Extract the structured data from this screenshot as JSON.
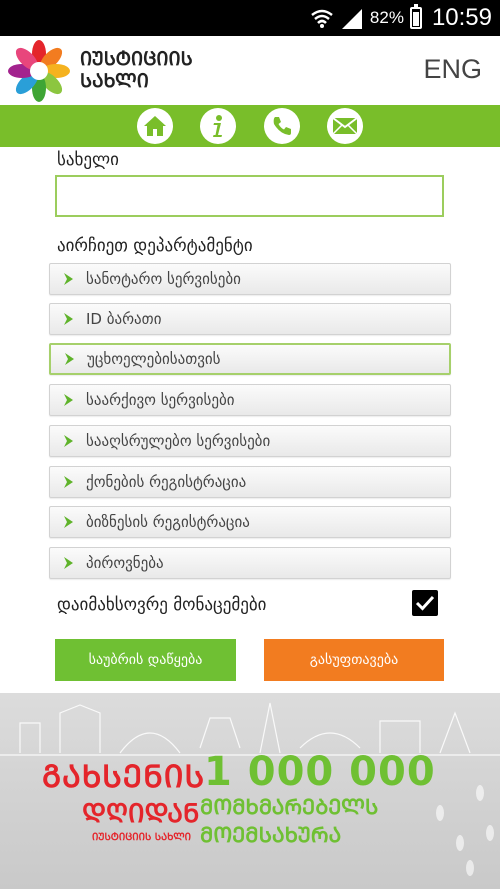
{
  "status_bar": {
    "battery": "82%",
    "time": "10:59"
  },
  "header": {
    "brand_line1": "ᲘᲣᲡᲢᲘᲪᲘᲘᲡ",
    "brand_line2": "ᲡᲐᲮᲚᲘ",
    "lang": "ENG"
  },
  "nav": {
    "icons": [
      "home-icon",
      "info-icon",
      "phone-icon",
      "mail-icon"
    ]
  },
  "form": {
    "name_label": "სახელი",
    "name_value": "",
    "dept_label": "აირჩიეთ დეპარტამენტი",
    "departments": [
      "სანოტარო სერვისები",
      "ID ბარათი",
      "უცხოელებისათვის",
      "საარქივო სერვისები",
      "სააღსრულებო სერვისები",
      "ქონების რეგისტრაცია",
      "ბიზნესის რეგისტრაცია",
      "პიროვნება"
    ],
    "selected_department": "უცხოელებისათვის",
    "remember_label": "დაიმახსოვრე მონაცემები",
    "remember_checked": true,
    "submit_label": "საუბრის დაწყება",
    "clear_label": "გასუფთავება"
  },
  "banner": {
    "red_line1": "ᲒᲐᲮᲡᲔᲜᲘᲡ",
    "red_line2": "ᲓᲦᲘᲓᲐᲜ",
    "red_line3": "ᲘᲣᲡᲢᲘᲪᲘᲘᲡ ᲡᲐᲮᲚᲘ",
    "number": "1 000 000",
    "green_line1": "ᲛᲝᲛᲮᲛᲐᲠᲔᲑᲔᲚᲡ",
    "green_line2": "ᲛᲝᲔᲛᲡᲐᲮᲣᲠᲐ"
  },
  "colors": {
    "accent_green": "#79be2a",
    "orange": "#f27c20",
    "red": "#e4252b"
  }
}
